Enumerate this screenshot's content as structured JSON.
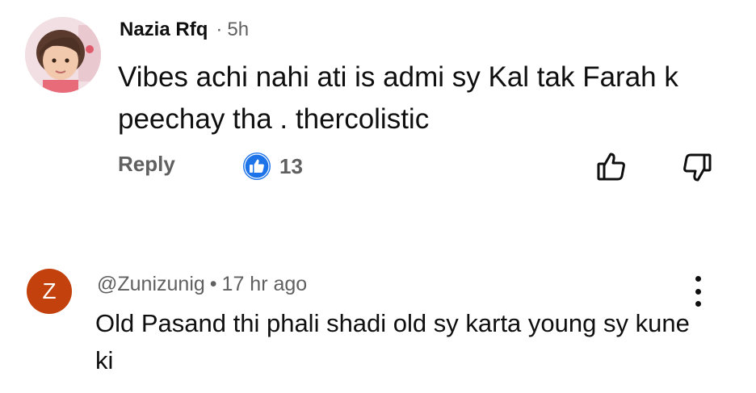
{
  "comments": [
    {
      "author": "Nazia Rfq",
      "separator": "·",
      "time": "5h",
      "text": "Vibes achi nahi ati is admi sy Kal tak Farah k peechay tha . thercolistic",
      "reply_label": "Reply",
      "like_count": "13",
      "like_badge_color": "#1d74e8"
    },
    {
      "author": "@Zunizunig",
      "separator": "•",
      "time": "17 hr ago",
      "avatar_letter": "Z",
      "avatar_color": "#c2410c",
      "text": "Old Pasand thi phali shadi old sy karta young sy kune ki"
    }
  ],
  "icons": {
    "like_badge": "thumbs-up-icon",
    "like": "thumbs-up-outline-icon",
    "dislike": "thumbs-down-outline-icon",
    "more": "more-vert-icon"
  }
}
